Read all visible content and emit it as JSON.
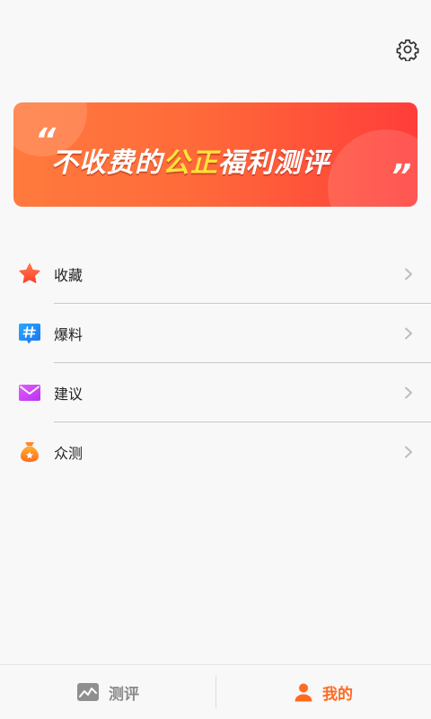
{
  "banner": {
    "quote_open": "“",
    "quote_close": "”",
    "slogan_part1": "不收费的",
    "slogan_highlight": "公正",
    "slogan_part2": "福利测评"
  },
  "menu": {
    "items": [
      {
        "label": "收藏",
        "icon": "star-icon"
      },
      {
        "label": "爆料",
        "icon": "hashtag-icon"
      },
      {
        "label": "建议",
        "icon": "mail-icon"
      },
      {
        "label": "众测",
        "icon": "money-bag-icon"
      }
    ]
  },
  "tabbar": {
    "tabs": [
      {
        "label": "测评",
        "icon": "chart-icon",
        "active": false
      },
      {
        "label": "我的",
        "icon": "user-icon",
        "active": true
      }
    ]
  },
  "colors": {
    "accent": "#ff6a1f",
    "banner_start": "#ff7a3d",
    "banner_end": "#ff3d3a",
    "highlight": "#ffe23a"
  }
}
